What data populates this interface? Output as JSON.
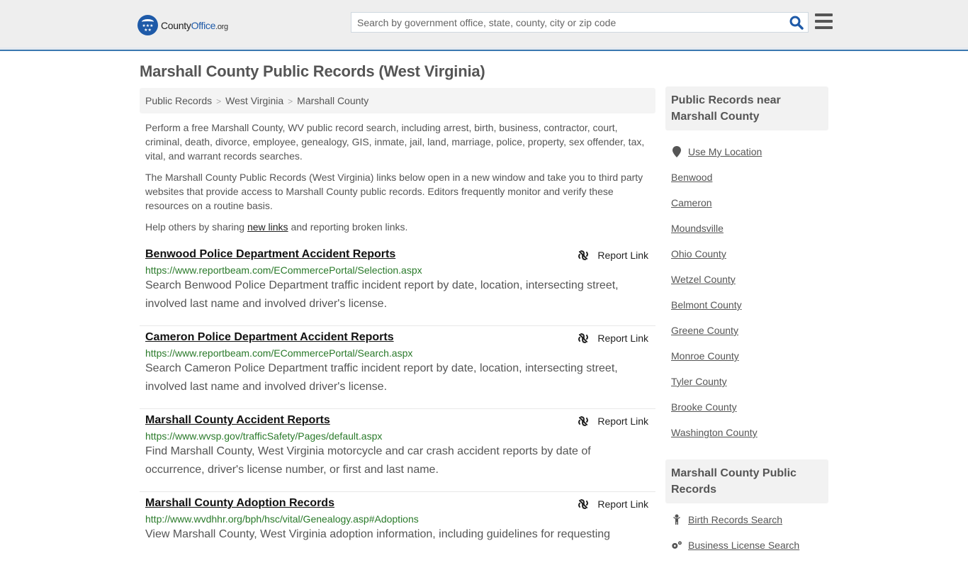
{
  "header": {
    "logo": {
      "part1": "County",
      "part2": "Office",
      "part3": ".org",
      "icon": "eagle-stars-badge"
    },
    "search": {
      "placeholder": "Search by government office, state, county, city or zip code",
      "value": "",
      "icon": "search-icon"
    },
    "menu_icon": "hamburger-menu-icon"
  },
  "page": {
    "title": "Marshall County Public Records (West Virginia)",
    "breadcrumb": [
      "Public Records",
      "West Virginia",
      "Marshall County"
    ],
    "intro": {
      "p1": "Perform a free Marshall County, WV public record search, including arrest, birth, business, contractor, court, criminal, death, divorce, employee, genealogy, GIS, inmate, jail, land, marriage, police, property, sex offender, tax, vital, and warrant records searches.",
      "p2": "The Marshall County Public Records (West Virginia) links below open in a new window and take you to third party websites that provide access to Marshall County public records. Editors frequently monitor and verify these resources on a routine basis.",
      "p3_before": "Help others by sharing ",
      "p3_link": "new links",
      "p3_after": " and reporting broken links."
    }
  },
  "records": [
    {
      "title": "Benwood Police Department Accident Reports",
      "url": "https://www.reportbeam.com/ECommercePortal/Selection.aspx",
      "description": "Search Benwood Police Department traffic incident report by date, location, intersecting street, involved last name and involved driver's license.",
      "report_label": "Report Link"
    },
    {
      "title": "Cameron Police Department Accident Reports",
      "url": "https://www.reportbeam.com/ECommercePortal/Search.aspx",
      "description": "Search Cameron Police Department traffic incident report by date, location, intersecting street, involved last name and involved driver's license.",
      "report_label": "Report Link"
    },
    {
      "title": "Marshall County Accident Reports",
      "url": "https://www.wvsp.gov/trafficSafety/Pages/default.aspx",
      "description": "Find Marshall County, West Virginia motorcycle and car crash accident reports by date of occurrence, driver's license number, or first and last name.",
      "report_label": "Report Link"
    },
    {
      "title": "Marshall County Adoption Records",
      "url": "http://www.wvdhhr.org/bph/hsc/vital/Genealogy.asp#Adoptions",
      "description": "View Marshall County, West Virginia adoption information, including guidelines for requesting",
      "report_label": "Report Link"
    }
  ],
  "sidebar": {
    "nearby": {
      "heading": "Public Records near Marshall County",
      "use_location": "Use My Location",
      "items": [
        "Benwood",
        "Cameron",
        "Moundsville",
        "Ohio County",
        "Wetzel County",
        "Belmont County",
        "Greene County",
        "Monroe County",
        "Tyler County",
        "Brooke County",
        "Washington County"
      ]
    },
    "county_records": {
      "heading": "Marshall County Public Records",
      "items": [
        {
          "label": "Birth Records Search",
          "icon": "baby-icon"
        },
        {
          "label": "Business License Search",
          "icon": "gears-icon"
        }
      ]
    }
  }
}
